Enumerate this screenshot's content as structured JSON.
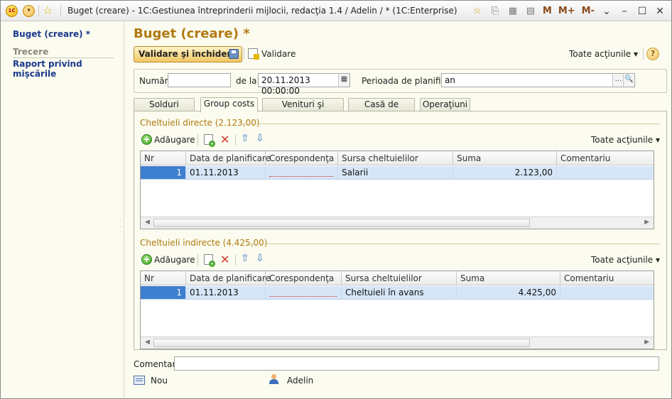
{
  "window": {
    "title": "Buget (creare) - 1C:Gestiunea întreprinderii mijlocii, redacţia 1.4 / Adelin / * (1C:Enterprise)",
    "logo_text": "1C",
    "memory_buttons": [
      "M",
      "M+",
      "M-"
    ]
  },
  "nav": {
    "current": "Buget (creare) *",
    "group": "Trecere",
    "links": [
      "Raport privind mişcările"
    ]
  },
  "form": {
    "title": "Buget (creare) *",
    "toolbar": {
      "post_close": "Validare şi închidere",
      "post": "Validare",
      "all_actions": "Toate acţiunile ▾",
      "help": "?"
    },
    "header": {
      "number_label": "Număr:",
      "number_value": "",
      "date_label": "de la:",
      "date_value": "20.11.2013 00:00:00",
      "period_label": "Perioada de planificare:",
      "period_value": "an",
      "select_btn": "...",
      "search_btn": "🔍"
    },
    "tabs": [
      {
        "label": "Solduri iniţiale"
      },
      {
        "label": "Group costs"
      },
      {
        "label": "Venituri şi cheltuieli"
      },
      {
        "label": "Casă de marcat"
      },
      {
        "label": "Operaţiuni"
      }
    ],
    "active_tab": "Group costs",
    "direct": {
      "title": "Cheltuieli directe (2.123,00)",
      "add": "Adăugare",
      "all_actions": "Toate acţiunile ▾",
      "columns": [
        "Nr",
        "Data de planificare",
        "Corespondenţa",
        "Sursa cheltuielilor",
        "Suma",
        "Comentariu"
      ],
      "rows": [
        {
          "nr": "1",
          "date": "01.11.2013",
          "corr": "",
          "source": "Salarii",
          "sum": "2.123,00",
          "comment": ""
        }
      ]
    },
    "indirect": {
      "title": "Cheltuieli indirecte (4.425,00)",
      "add": "Adăugare",
      "all_actions": "Toate acţiunile ▾",
      "columns": [
        "Nr",
        "Data de planificare",
        "Corespondenţa",
        "Sursa cheltuielilor",
        "Suma",
        "Comentariu"
      ],
      "rows": [
        {
          "nr": "1",
          "date": "01.11.2013",
          "corr": "",
          "source": "Cheltuieli în avans",
          "sum": "4.425,00",
          "comment": ""
        }
      ]
    },
    "footer": {
      "comment_label": "Comentariu:",
      "comment_value": "",
      "status": "Nou",
      "user": "Adelin"
    }
  }
}
